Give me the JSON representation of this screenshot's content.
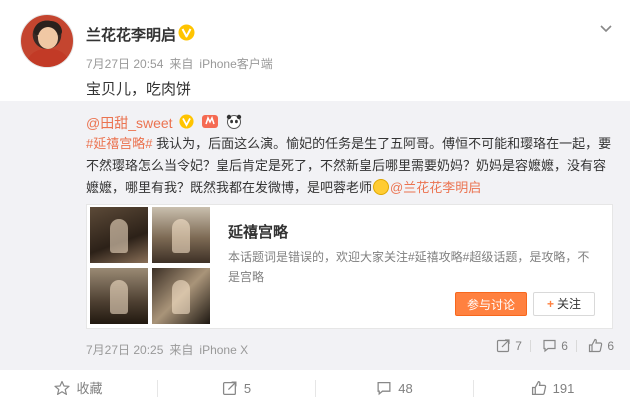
{
  "post": {
    "author": "兰花花李明启",
    "date": "7月27日 20:54",
    "source_prefix": "来自",
    "source": "iPhone客户端",
    "text": "宝贝儿，吃肉饼"
  },
  "retweet": {
    "user": "@田甜_sweet",
    "hashtag": "#延禧宫略#",
    "text": " 我认为，后面这么演。愉妃的任务是生了五阿哥。傅恒不可能和璎珞在一起，要不然璎珞怎么当令妃？皇后肯定是死了，不然新皇后哪里需要奶妈？奶妈是容嬷嬷，没有容嬷嬷，哪里有我？既然我都在发微博，是吧蓉老师",
    "mention": "@兰花花李明启",
    "card": {
      "title": "延禧宫略",
      "description": "本话题词是错误的，欢迎大家关注#延禧攻略#超级话题，是攻略，不是宫略",
      "join_label": "参与讨论",
      "follow_label": "关注"
    },
    "date": "7月27日 20:25",
    "source_prefix": "来自",
    "source": "iPhone X",
    "reposts": "7",
    "comments": "6",
    "likes": "6"
  },
  "footer": {
    "favorite_label": "收藏",
    "reposts": "5",
    "comments": "48",
    "likes": "191"
  },
  "colors": {
    "accent": "#eb7350",
    "button": "#ff8140",
    "muted": "#999999",
    "retweet_bg": "#f2f2f5"
  },
  "icons": [
    "verified-v-icon",
    "chevron-down-icon",
    "share-icon",
    "comment-icon",
    "like-icon",
    "favorite-icon",
    "plus-icon"
  ]
}
